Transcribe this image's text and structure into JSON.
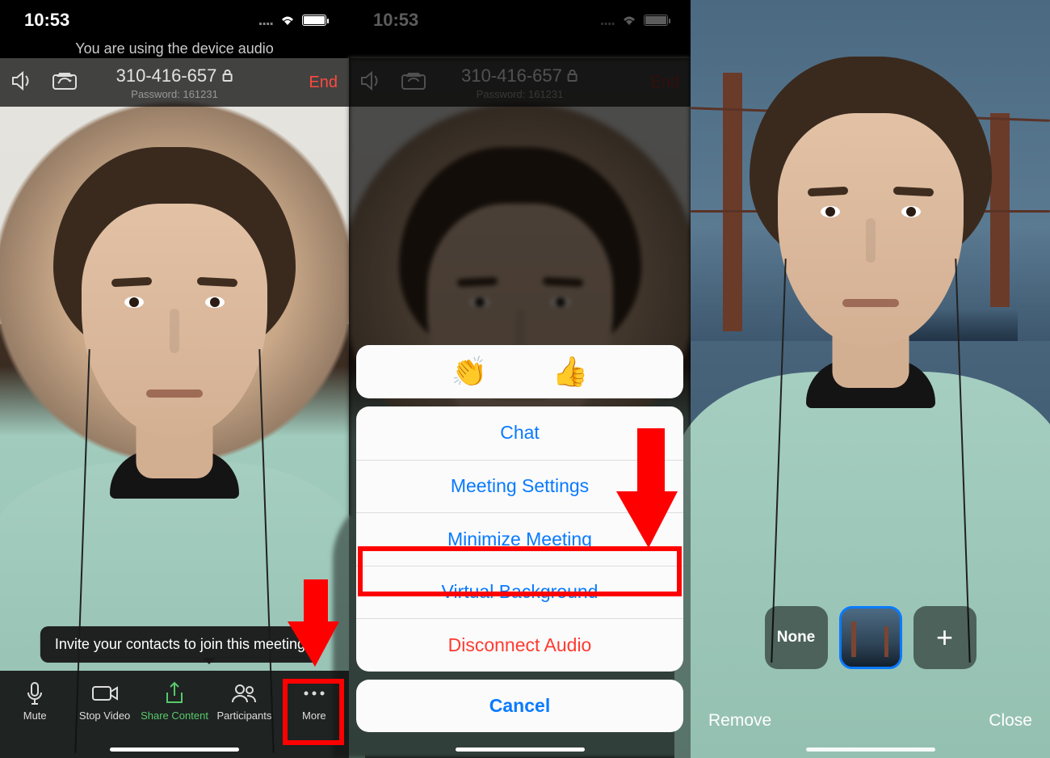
{
  "status": {
    "time": "10:53"
  },
  "banner": "You are using the device audio",
  "meeting": {
    "id": "310-416-657",
    "password_label": "Password: 161231",
    "end": "End"
  },
  "tooltip": "Invite your contacts to join this meeting",
  "toolbar": {
    "mute": "Mute",
    "stop_video": "Stop Video",
    "share": "Share Content",
    "participants": "Participants",
    "more": "More"
  },
  "sheet": {
    "emoji_clap": "👏",
    "emoji_thumb": "👍",
    "chat": "Chat",
    "settings": "Meeting Settings",
    "minimize": "Minimize Meeting",
    "virtual_bg": "Virtual Background",
    "disconnect": "Disconnect Audio",
    "cancel": "Cancel"
  },
  "bgstrip": {
    "none": "None",
    "add": "+",
    "remove": "Remove",
    "close": "Close"
  }
}
